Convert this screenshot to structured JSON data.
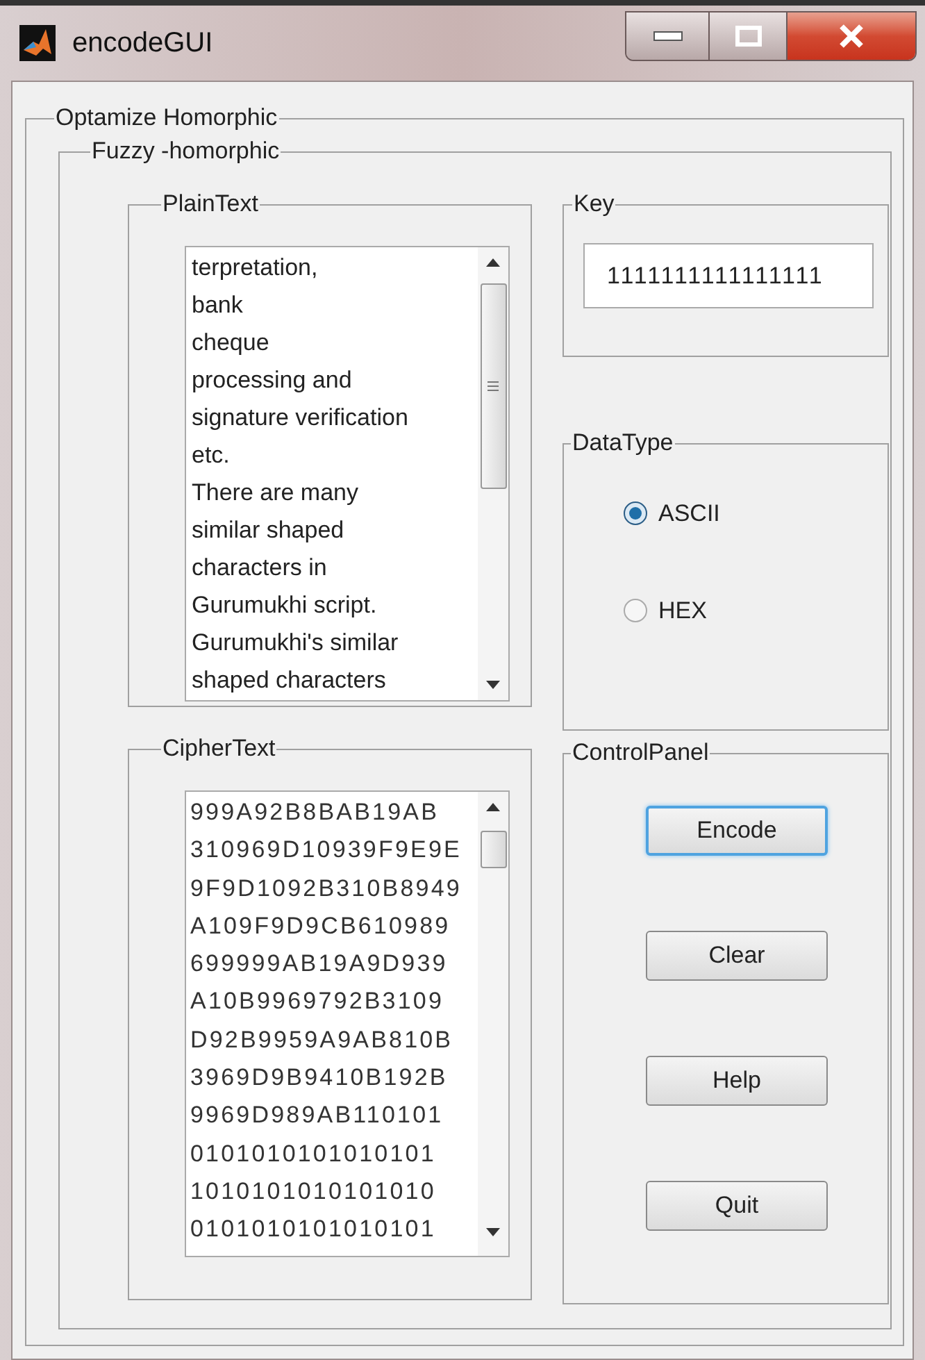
{
  "window": {
    "title": "encodeGUI"
  },
  "outer_panel": {
    "title": "Optamize Homorphic"
  },
  "inner_panel": {
    "title": "Fuzzy -homorphic"
  },
  "plaintext": {
    "title": "PlainText",
    "lines": [
      "terpretation,",
      "bank",
      "cheque",
      "processing and",
      "signature verification",
      "etc.",
      "There are many",
      "similar shaped",
      "characters in",
      "Gurumukhi script.",
      "Gurumukhi's similar",
      "shaped characters"
    ]
  },
  "key": {
    "title": "Key",
    "value": "1111111111111111"
  },
  "datatype": {
    "title": "DataType",
    "options": [
      {
        "label": "ASCII",
        "selected": true
      },
      {
        "label": "HEX",
        "selected": false
      }
    ]
  },
  "ciphertext": {
    "title": "CipherText",
    "lines": [
      "999A92B8BAB19AB",
      "310969D10939F9E9E",
      "9F9D1092B310B8949",
      "A109F9D9CB610989",
      "699999AB19A9D939",
      "A10B9969792B3109",
      "D92B9959A9AB810B",
      "3969D9B9410B192B",
      "9969D989AB110101",
      "0101010101010101",
      "1010101010101010",
      "0101010101010101"
    ]
  },
  "control_panel": {
    "title": "ControlPanel",
    "buttons": [
      {
        "label": "Encode",
        "focused": true
      },
      {
        "label": "Clear",
        "focused": false
      },
      {
        "label": "Help",
        "focused": false
      },
      {
        "label": "Quit",
        "focused": false
      }
    ]
  }
}
